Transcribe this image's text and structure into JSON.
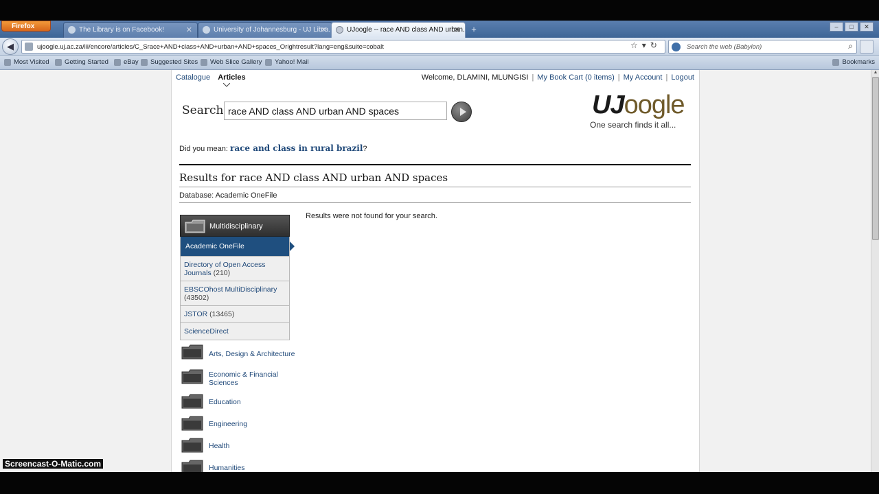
{
  "browser": {
    "menu_button": "Firefox",
    "tabs": [
      {
        "label": "The Library is on Facebook!",
        "active": false
      },
      {
        "label": "University of Johannesburg - UJ Libra...",
        "active": false
      },
      {
        "label": "UJoogle -- race AND class AND urban...",
        "active": true
      }
    ],
    "new_tab": "+",
    "url": "ujoogle.uj.ac.za/iii/encore/articles/C_Srace+AND+class+AND+urban+AND+spaces_Orightresult?lang=eng&suite=cobalt",
    "search_placeholder": "Search the web (Babylon)",
    "bookmarks": [
      "Most Visited",
      "Getting Started",
      "eBay",
      "Suggested Sites",
      "Web Slice Gallery",
      "Yahoo! Mail"
    ],
    "bookmarks_right": "Bookmarks"
  },
  "site": {
    "nav_tabs": [
      {
        "label": "Catalogue",
        "active": false
      },
      {
        "label": "Articles",
        "active": true
      }
    ],
    "welcome": "Welcome, DLAMINI, MLUNGISI",
    "book_cart": "My Book Cart (0 items)",
    "my_account": "My Account",
    "logout": "Logout",
    "search_label": "Search",
    "search_value": "race AND class AND urban AND spaces",
    "logo_uj": "UJ",
    "logo_rest": "oogle",
    "tagline": "One search finds it all...",
    "did_you_mean_prefix": "Did you mean:",
    "did_you_mean_link": "race and class in rural brazil",
    "did_you_mean_suffix": "?",
    "results_title": "Results for race AND class AND urban AND spaces",
    "database_line": "Database: Academic OneFile",
    "no_results": "Results were not found for your search."
  },
  "facet": {
    "header": "Multidisciplinary",
    "items": [
      {
        "label": "Academic OneFile",
        "count": "",
        "active": true
      },
      {
        "label": "Directory of Open Access Journals",
        "count": "(210)",
        "active": false
      },
      {
        "label": "EBSCOhost MultiDisciplinary",
        "count": "(43502)",
        "active": false
      },
      {
        "label": "JSTOR",
        "count": "(13465)",
        "active": false
      },
      {
        "label": "ScienceDirect",
        "count": "",
        "active": false
      }
    ]
  },
  "categories": [
    "Arts, Design & Architecture",
    "Economic & Financial Sciences",
    "Education",
    "Engineering",
    "Health",
    "Humanities"
  ],
  "overlay": {
    "watermark": "Screencast-O-Matic.com"
  }
}
